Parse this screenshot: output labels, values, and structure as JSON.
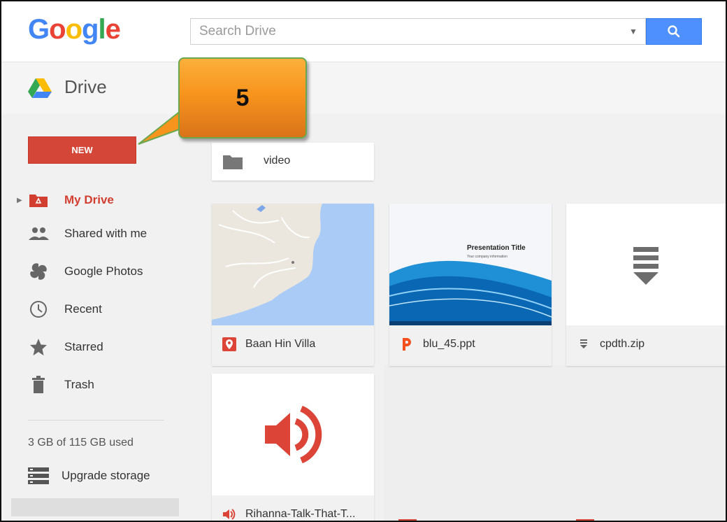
{
  "header": {
    "logo_letters": [
      "G",
      "o",
      "o",
      "g",
      "l",
      "e"
    ],
    "search_placeholder": "Search Drive"
  },
  "drive_bar": {
    "title": "Drive"
  },
  "sidebar": {
    "new_label": "NEW",
    "items": [
      {
        "label": "My Drive",
        "icon": "my-drive-icon",
        "active": true
      },
      {
        "label": "Shared with me",
        "icon": "shared-icon"
      },
      {
        "label": "Google Photos",
        "icon": "photos-icon"
      },
      {
        "label": "Recent",
        "icon": "clock-icon"
      },
      {
        "label": "Starred",
        "icon": "star-icon"
      },
      {
        "label": "Trash",
        "icon": "trash-icon"
      }
    ],
    "quota": "3 GB of 115 GB used",
    "upgrade_label": "Upgrade storage"
  },
  "callout": {
    "label": "5",
    "color": "#f7941d"
  },
  "folders": [
    {
      "name": "video"
    }
  ],
  "files": [
    {
      "name": "Baan Hin Villa",
      "type": "map",
      "icon": "map-pin-icon"
    },
    {
      "name": "blu_45.ppt",
      "type": "presentation",
      "icon": "powerpoint-icon",
      "thumb_title": "Presentation Title",
      "thumb_subtitle": "Your company information"
    },
    {
      "name": "cpdth.zip",
      "type": "archive",
      "icon": "archive-icon"
    },
    {
      "name": "Rihanna-Talk-That-T...",
      "type": "audio",
      "icon": "audio-icon"
    }
  ],
  "colors": {
    "accent_red": "#d44638",
    "search_blue": "#4d90fe"
  }
}
